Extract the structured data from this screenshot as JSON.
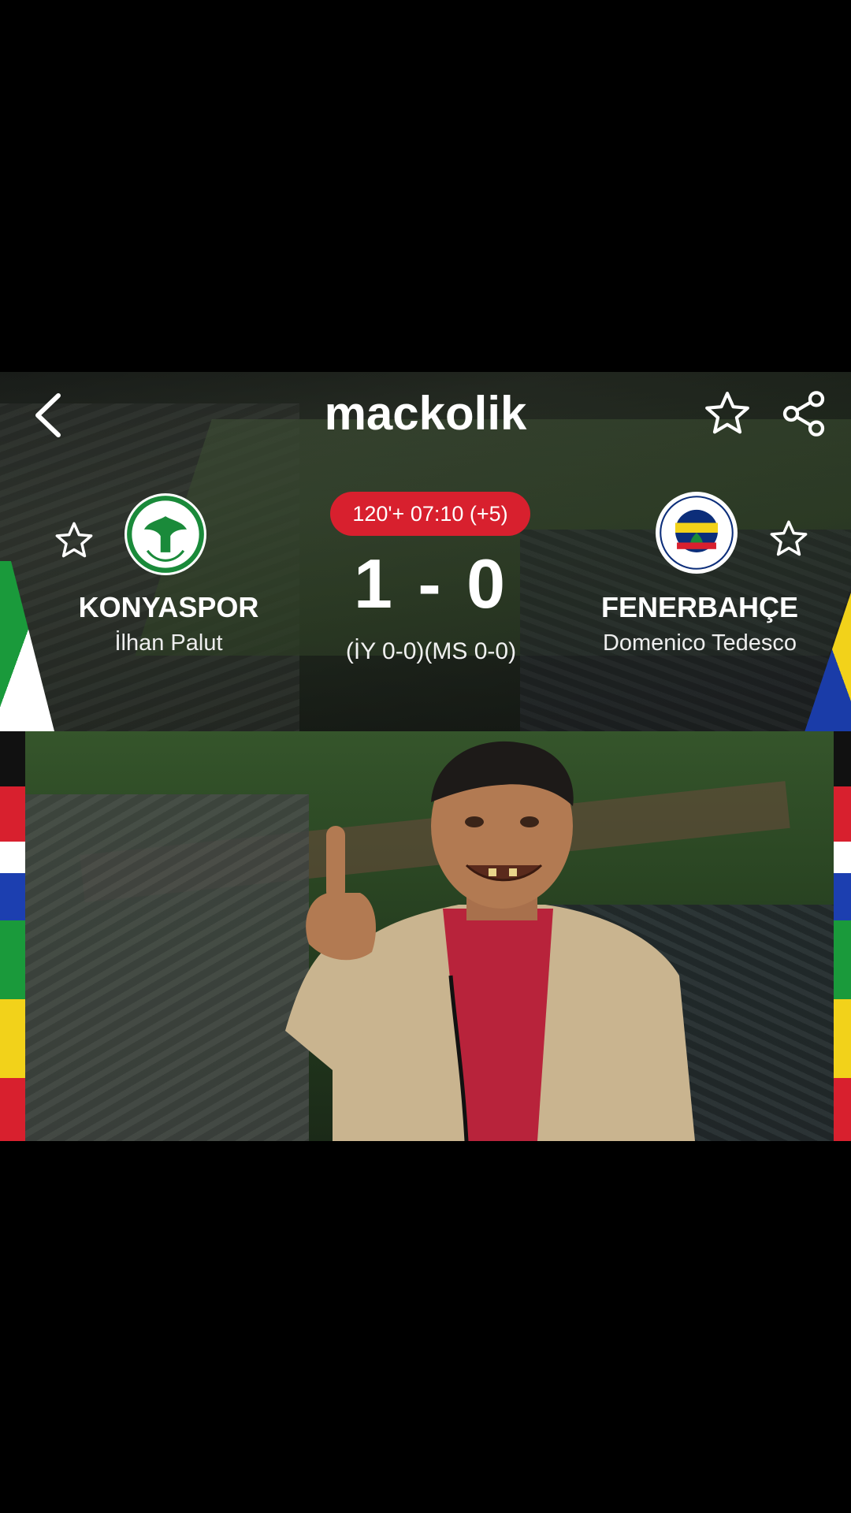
{
  "header": {
    "brand": "mackolik",
    "back_icon": "chevron-left-icon",
    "favorite_icon": "star-outline-icon",
    "share_icon": "share-icon"
  },
  "match": {
    "time_status": "120'+ 07:10 (+5)",
    "score": "1 - 0",
    "sub_score": "(İY 0-0)(MS 0-0)",
    "status_color": "#d8202e"
  },
  "home_team": {
    "name": "KONYASPOR",
    "coach": "İlhan Palut",
    "logo_icon": "konyaspor-crest-icon",
    "favorite_icon": "star-outline-icon",
    "color": "#1a8a3a"
  },
  "away_team": {
    "name": "FENERBAHÇE",
    "coach": "Domenico Tedesco",
    "logo_icon": "fenerbahce-crest-icon",
    "favorite_icon": "star-outline-icon",
    "color": "#0c2e7a"
  },
  "meme": {
    "content": "person-gesturing-in-stadium-image"
  }
}
